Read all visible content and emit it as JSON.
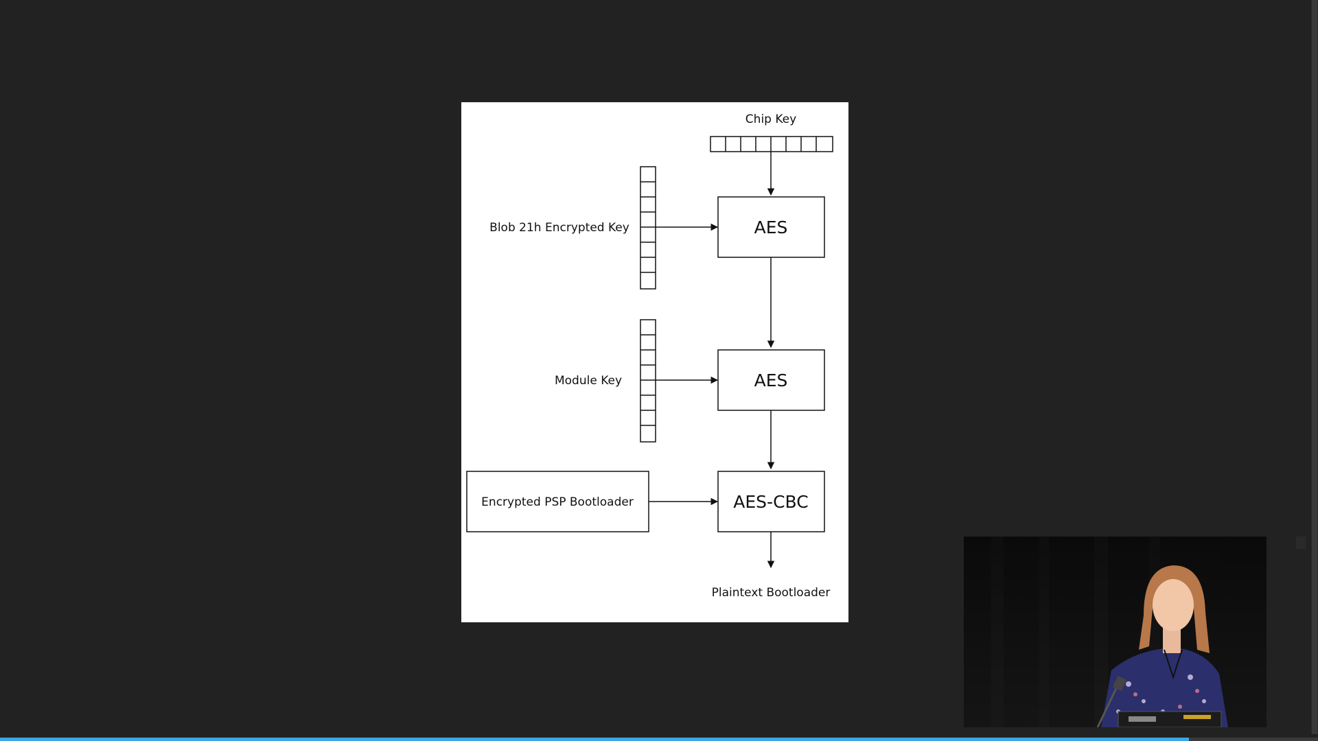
{
  "diagram": {
    "chip_key_label": "Chip Key",
    "blob_key_label": "Blob 21h Encrypted Key",
    "module_key_label": "Module Key",
    "aes_box_1": "AES",
    "aes_box_2": "AES",
    "aes_cbc_box": "AES-CBC",
    "encrypted_bootloader_label": "Encrypted PSP Bootloader",
    "plaintext_bootloader_label": "Plaintext Bootloader"
  },
  "player": {
    "progress_fraction": 0.902,
    "time_text": "",
    "accent_color": "#3aa6e6"
  },
  "colors": {
    "background": "#222222",
    "slide": "#ffffff",
    "stroke": "#111111"
  }
}
